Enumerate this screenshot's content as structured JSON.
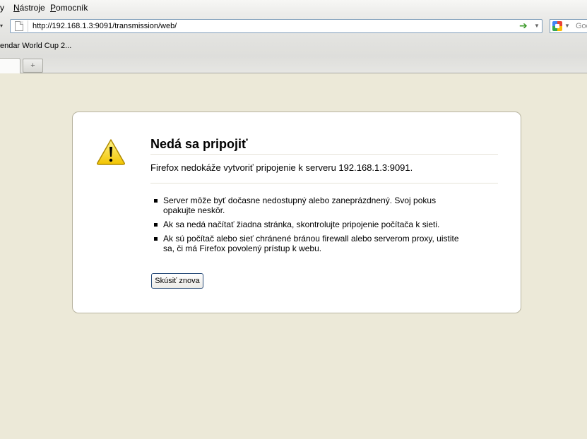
{
  "menu": {
    "items": [
      {
        "lead": "",
        "accel": "",
        "rest": "y"
      },
      {
        "lead": "",
        "accel": "N",
        "rest": "ástroje"
      },
      {
        "lead": "",
        "accel": "P",
        "rest": "omocník"
      }
    ]
  },
  "navbar": {
    "url": "http://192.168.1.3:9091/transmission/web/",
    "search_placeholder": "Goo",
    "go_icon": "go-arrow-icon"
  },
  "bookmarks": {
    "items": [
      "endar World Cup 2..."
    ]
  },
  "tabs": {
    "new_tab_glyph": "+"
  },
  "error": {
    "title": "Nedá sa pripojiť",
    "short": "Firefox nedokáže vytvoriť pripojenie k serveru 192.168.1.3:9091.",
    "items": [
      "Server môže byť dočasne nedostupný alebo zaneprázdnený. Svoj pokus opakujte neskôr.",
      "Ak sa nedá načítať žiadna stránka, skontrolujte pripojenie počítača k sieti.",
      "Ak sú počítač alebo sieť chránené bránou firewall alebo serverom proxy, uistite sa, či má Firefox povolený prístup k webu."
    ],
    "retry_label": "Skúsiť znova"
  },
  "colors": {
    "page_background": "#ece9d8",
    "warning_yellow": "#f5d000",
    "go_green": "#3c9a2a"
  }
}
